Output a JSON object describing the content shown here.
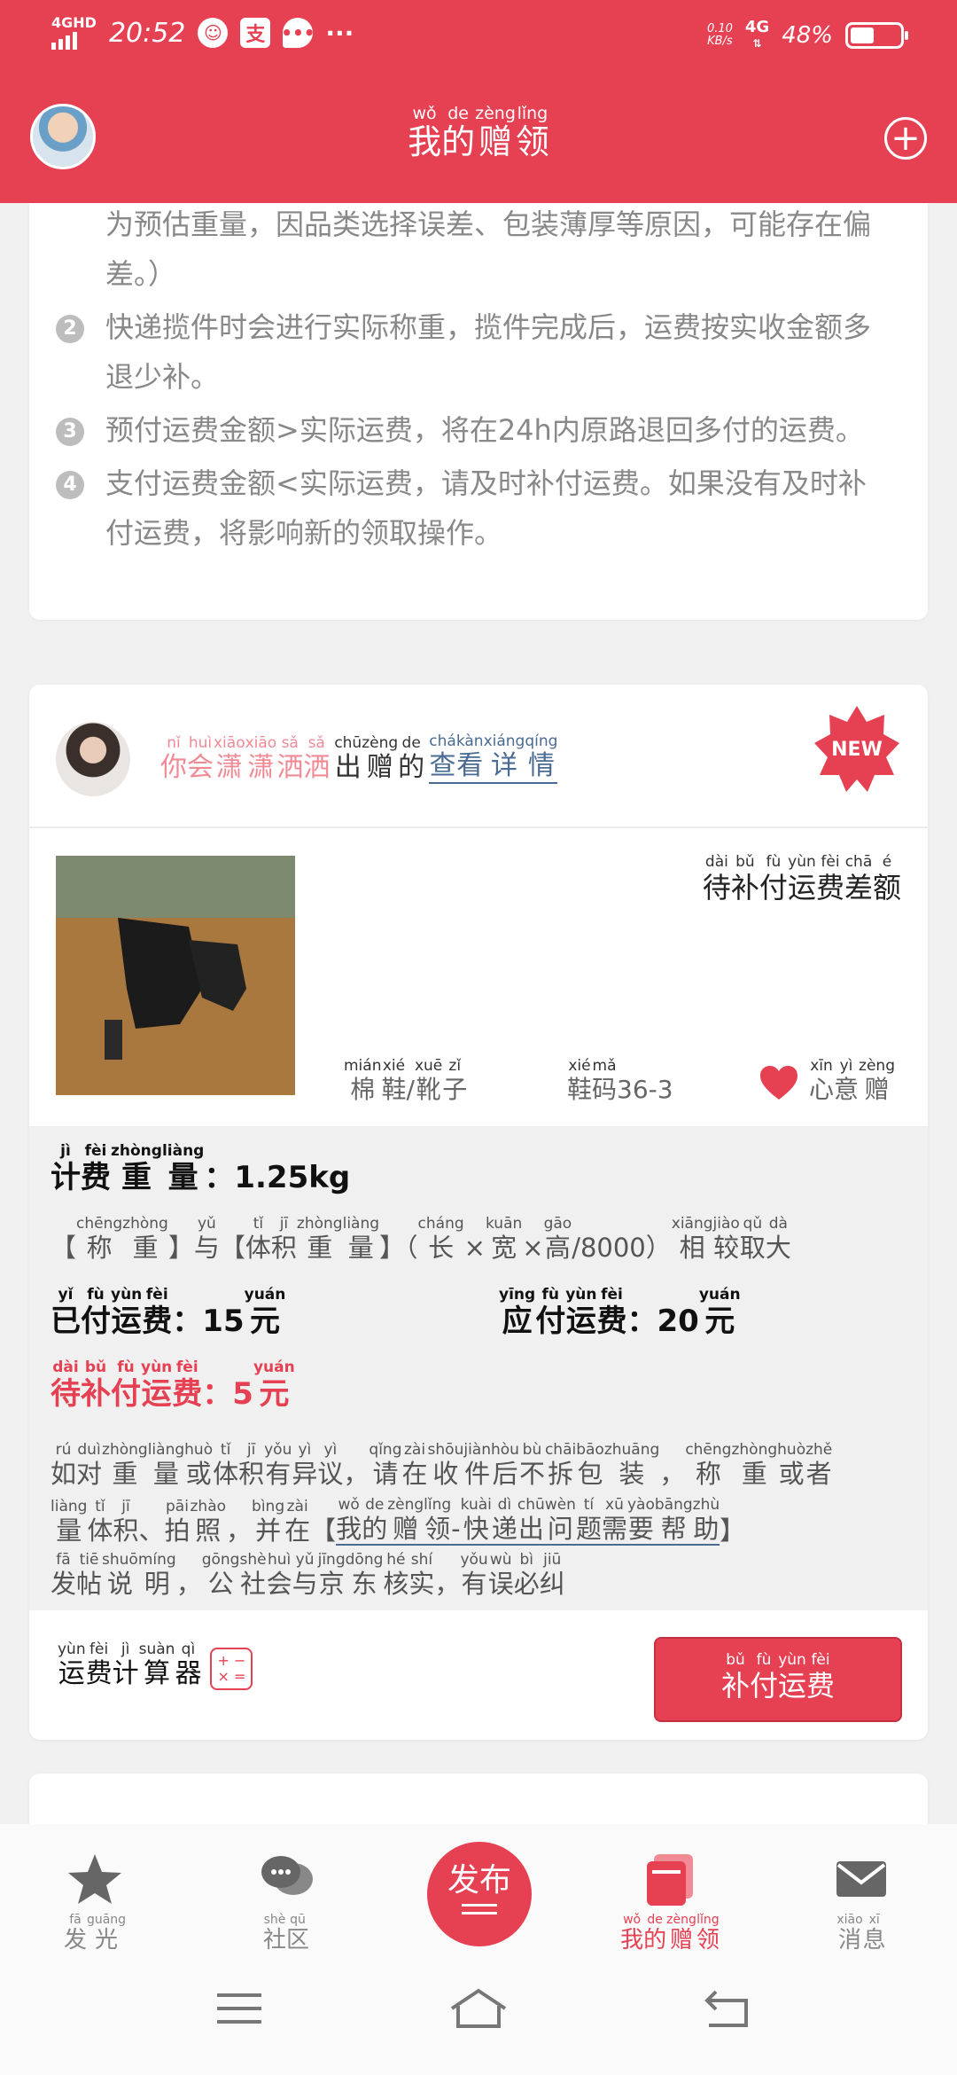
{
  "status": {
    "network_left": "4GHD",
    "time": "20:52",
    "app_icons": [
      "face-app-icon",
      "alipay-icon",
      "chat-bubble-icon"
    ],
    "more": "···",
    "speed_value": "0.10",
    "speed_unit": "KB/s",
    "network_right": "4G",
    "battery_percent": "48%",
    "battery_level": 0.48
  },
  "header": {
    "title": [
      {
        "py": "wǒ",
        "hz": "我"
      },
      {
        "py": "de",
        "hz": "的"
      },
      {
        "py": "zèng",
        "hz": "赠"
      },
      {
        "py": "lǐng",
        "hz": "领"
      }
    ],
    "add_icon": "plus-circle-icon"
  },
  "rules": [
    {
      "num": "",
      "lines": [
        "为预估重量，因品类选择误差、包装薄厚等原因，可能存在偏",
        "差。）"
      ]
    },
    {
      "num": "2",
      "lines": [
        "快递揽件时会进行实际称重，揽件完成后，运费按实收金额多",
        "退少补。"
      ]
    },
    {
      "num": "3",
      "lines": [
        "预付运费金额>实际运费，将在24h内原路退回多付的运费。"
      ]
    },
    {
      "num": "4",
      "lines": [
        "支付运费金额<实际运费，请及时补付运费。如果没有及时补",
        "付运费，将影响新的领取操作。"
      ]
    }
  ],
  "item": {
    "donor_name": [
      {
        "py": "nǐ",
        "hz": "你"
      },
      {
        "py": "huì",
        "hz": "会"
      },
      {
        "py": "xiāo",
        "hz": "潇"
      },
      {
        "py": "xiāo",
        "hz": "潇"
      },
      {
        "py": "sǎ",
        "hz": "洒"
      },
      {
        "py": "sǎ",
        "hz": "洒"
      }
    ],
    "donated_suffix": [
      {
        "py": "chū",
        "hz": "出"
      },
      {
        "py": "zèng",
        "hz": "赠"
      },
      {
        "py": "de",
        "hz": "的"
      }
    ],
    "view_details": [
      {
        "py": "chá",
        "hz": "查"
      },
      {
        "py": "kàn",
        "hz": "看"
      },
      {
        "py": "xiáng",
        "hz": "详"
      },
      {
        "py": "qíng",
        "hz": "情"
      }
    ],
    "new_badge": "NEW",
    "status_text": [
      {
        "py": "dài",
        "hz": "待"
      },
      {
        "py": "bǔ",
        "hz": "补"
      },
      {
        "py": "fù",
        "hz": "付"
      },
      {
        "py": "yùn",
        "hz": "运"
      },
      {
        "py": "fèi",
        "hz": "费"
      },
      {
        "py": "chā",
        "hz": "差"
      },
      {
        "py": "é",
        "hz": "额"
      }
    ],
    "category": [
      {
        "py": "mián",
        "hz": "棉"
      },
      {
        "py": "xié",
        "hz": "鞋"
      },
      {
        "py": "",
        "hz": "/"
      },
      {
        "py": "xuē",
        "hz": "靴"
      },
      {
        "py": "zǐ",
        "hz": "子"
      }
    ],
    "size": [
      {
        "py": "xié",
        "hz": "鞋"
      },
      {
        "py": "mǎ",
        "hz": "码"
      },
      {
        "py": "",
        "hz": "36-3"
      }
    ],
    "wish": [
      {
        "py": "xīn",
        "hz": "心"
      },
      {
        "py": "yì",
        "hz": "意"
      },
      {
        "py": "zèng",
        "hz": "赠"
      }
    ],
    "billing_weight": {
      "label": [
        {
          "py": "jì",
          "hz": "计"
        },
        {
          "py": "fèi",
          "hz": "费"
        },
        {
          "py": "zhòng",
          "hz": "重"
        },
        {
          "py": "liàng",
          "hz": "量"
        }
      ],
      "value": "：1.25kg"
    },
    "compare_note": [
      {
        "py": "",
        "hz": "【"
      },
      {
        "py": "chēng",
        "hz": "称"
      },
      {
        "py": "zhòng",
        "hz": "重"
      },
      {
        "py": "",
        "hz": "】"
      },
      {
        "py": "yǔ",
        "hz": "与"
      },
      {
        "py": "",
        "hz": "【"
      },
      {
        "py": "tǐ",
        "hz": "体"
      },
      {
        "py": "jī",
        "hz": "积"
      },
      {
        "py": "zhòng",
        "hz": "重"
      },
      {
        "py": "liàng",
        "hz": "量"
      },
      {
        "py": "",
        "hz": "】（"
      },
      {
        "py": "cháng",
        "hz": "长"
      },
      {
        "py": "",
        "hz": "×"
      },
      {
        "py": "kuān",
        "hz": "宽"
      },
      {
        "py": "",
        "hz": "×"
      },
      {
        "py": "gāo",
        "hz": "高"
      },
      {
        "py": "",
        "hz": "/8000）"
      },
      {
        "py": "xiāng",
        "hz": "相"
      },
      {
        "py": "jiào",
        "hz": "较"
      },
      {
        "py": "qǔ",
        "hz": "取"
      },
      {
        "py": "dà",
        "hz": "大"
      }
    ],
    "paid_freight": {
      "label": [
        {
          "py": "yǐ",
          "hz": "已"
        },
        {
          "py": "fù",
          "hz": "付"
        },
        {
          "py": "yùn",
          "hz": "运"
        },
        {
          "py": "fèi",
          "hz": "费"
        }
      ],
      "value": "：15",
      "unit": {
        "py": "yuán",
        "hz": "元"
      }
    },
    "due_freight": {
      "label": [
        {
          "py": "yīng",
          "hz": "应"
        },
        {
          "py": "fù",
          "hz": "付"
        },
        {
          "py": "yùn",
          "hz": "运"
        },
        {
          "py": "fèi",
          "hz": "费"
        }
      ],
      "value": "：20",
      "unit": {
        "py": "yuán",
        "hz": "元"
      }
    },
    "pending_freight": {
      "label": [
        {
          "py": "dài",
          "hz": "待"
        },
        {
          "py": "bǔ",
          "hz": "补"
        },
        {
          "py": "fù",
          "hz": "付"
        },
        {
          "py": "yùn",
          "hz": "运"
        },
        {
          "py": "fèi",
          "hz": "费"
        }
      ],
      "value": "：5",
      "unit": {
        "py": "yuán",
        "hz": "元"
      }
    },
    "dispute_line1": [
      {
        "py": "rú",
        "hz": "如"
      },
      {
        "py": "duì",
        "hz": "对"
      },
      {
        "py": "zhòng",
        "hz": "重"
      },
      {
        "py": "liàng",
        "hz": "量"
      },
      {
        "py": "huò",
        "hz": "或"
      },
      {
        "py": "tǐ",
        "hz": "体"
      },
      {
        "py": "jī",
        "hz": "积"
      },
      {
        "py": "yǒu",
        "hz": "有"
      },
      {
        "py": "yì",
        "hz": "异"
      },
      {
        "py": "yì",
        "hz": "议"
      },
      {
        "py": "",
        "hz": "，"
      },
      {
        "py": "qǐng",
        "hz": "请"
      },
      {
        "py": "zài",
        "hz": "在"
      },
      {
        "py": "shōu",
        "hz": "收"
      },
      {
        "py": "jiàn",
        "hz": "件"
      },
      {
        "py": "hòu",
        "hz": "后"
      },
      {
        "py": "bù",
        "hz": "不"
      },
      {
        "py": "chāi",
        "hz": "拆"
      },
      {
        "py": "bāo",
        "hz": "包"
      },
      {
        "py": "zhuāng",
        "hz": "装"
      },
      {
        "py": "",
        "hz": "，"
      },
      {
        "py": "chēng",
        "hz": "称"
      },
      {
        "py": "zhòng",
        "hz": "重"
      },
      {
        "py": "huò",
        "hz": "或"
      },
      {
        "py": "zhě",
        "hz": "者"
      }
    ],
    "dispute_line2_pre": [
      {
        "py": "liàng",
        "hz": "量"
      },
      {
        "py": "tǐ",
        "hz": "体"
      },
      {
        "py": "jī",
        "hz": "积"
      },
      {
        "py": "",
        "hz": "、"
      },
      {
        "py": "pāi",
        "hz": "拍"
      },
      {
        "py": "zhào",
        "hz": "照"
      },
      {
        "py": "",
        "hz": "，"
      },
      {
        "py": "bìng",
        "hz": "并"
      },
      {
        "py": "zài",
        "hz": "在"
      },
      {
        "py": "",
        "hz": "【"
      }
    ],
    "dispute_link": [
      {
        "py": "wǒ",
        "hz": "我"
      },
      {
        "py": "de",
        "hz": "的"
      },
      {
        "py": "zèng",
        "hz": "赠"
      },
      {
        "py": "lǐng",
        "hz": "领"
      },
      {
        "py": "",
        "hz": "-"
      },
      {
        "py": "kuài",
        "hz": "快"
      },
      {
        "py": "dì",
        "hz": "递"
      },
      {
        "py": "chū",
        "hz": "出"
      },
      {
        "py": "wèn",
        "hz": "问"
      },
      {
        "py": "tí",
        "hz": "题"
      },
      {
        "py": "xū",
        "hz": "需"
      },
      {
        "py": "yào",
        "hz": "要"
      },
      {
        "py": "bāng",
        "hz": "帮"
      },
      {
        "py": "zhù",
        "hz": "助"
      }
    ],
    "dispute_line2_post": [
      {
        "py": "",
        "hz": "】"
      }
    ],
    "dispute_line3": [
      {
        "py": "fā",
        "hz": "发"
      },
      {
        "py": "tiē",
        "hz": "帖"
      },
      {
        "py": "shuō",
        "hz": "说"
      },
      {
        "py": "míng",
        "hz": "明"
      },
      {
        "py": "",
        "hz": "，"
      },
      {
        "py": "gōng",
        "hz": "公"
      },
      {
        "py": "shè",
        "hz": "社"
      },
      {
        "py": "huì",
        "hz": "会"
      },
      {
        "py": "yǔ",
        "hz": "与"
      },
      {
        "py": "jīng",
        "hz": "京"
      },
      {
        "py": "dōng",
        "hz": "东"
      },
      {
        "py": "hé",
        "hz": "核"
      },
      {
        "py": "shí",
        "hz": "实"
      },
      {
        "py": "",
        "hz": "，"
      },
      {
        "py": "yǒu",
        "hz": "有"
      },
      {
        "py": "wù",
        "hz": "误"
      },
      {
        "py": "bì",
        "hz": "必"
      },
      {
        "py": "jiū",
        "hz": "纠"
      }
    ],
    "calculator": [
      {
        "py": "yùn",
        "hz": "运"
      },
      {
        "py": "fèi",
        "hz": "费"
      },
      {
        "py": "jì",
        "hz": "计"
      },
      {
        "py": "suàn",
        "hz": "算"
      },
      {
        "py": "qì",
        "hz": "器"
      }
    ],
    "calculator_icon": "calculator-icon",
    "pay_button": [
      {
        "py": "bǔ",
        "hz": "补"
      },
      {
        "py": "fù",
        "hz": "付"
      },
      {
        "py": "yùn",
        "hz": "运"
      },
      {
        "py": "fèi",
        "hz": "费"
      }
    ]
  },
  "bottom_nav": [
    {
      "icon": "star-icon",
      "label": [
        {
          "py": "fā",
          "hz": "发"
        },
        {
          "py": "guāng",
          "hz": "光"
        }
      ],
      "active": false
    },
    {
      "icon": "chat-bubbles-icon",
      "label": [
        {
          "py": "shè",
          "hz": "社"
        },
        {
          "py": "qū",
          "hz": "区"
        }
      ],
      "active": false
    },
    {
      "icon": "book-stack-icon",
      "label": [
        {
          "py": "wǒ",
          "hz": "我"
        },
        {
          "py": "de",
          "hz": "的"
        },
        {
          "py": "zèng",
          "hz": "赠"
        },
        {
          "py": "lǐng",
          "hz": "领"
        }
      ],
      "active": true
    },
    {
      "icon": "envelope-icon",
      "label": [
        {
          "py": "xiāo",
          "hz": "消"
        },
        {
          "py": "xī",
          "hz": "息"
        }
      ],
      "active": false
    }
  ],
  "publish_button": "发布",
  "colors": {
    "accent": "#e64053",
    "link": "#4a6b94",
    "donor_name": "#f08a95",
    "background": "#f1f1f1"
  }
}
